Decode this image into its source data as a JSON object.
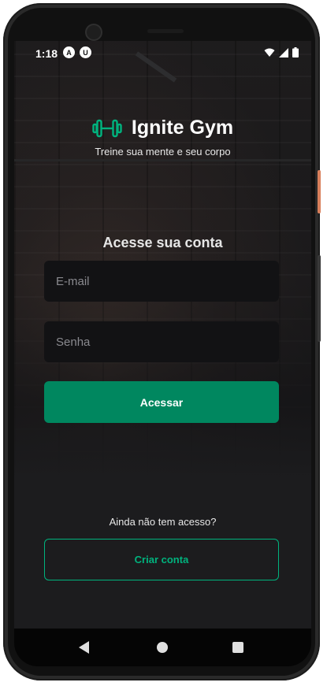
{
  "status_bar": {
    "time": "1:18",
    "notification_icons": [
      "A",
      "U"
    ]
  },
  "brand": {
    "name": "Ignite Gym",
    "tagline": "Treine sua mente e seu corpo",
    "icon": "dumbbell-icon",
    "accent_color": "#00b37e"
  },
  "login": {
    "heading": "Acesse sua conta",
    "email_placeholder": "E-mail",
    "password_placeholder": "Senha",
    "submit_label": "Acessar",
    "button_color": "#00875f"
  },
  "signup": {
    "prompt": "Ainda não tem acesso?",
    "button_label": "Criar conta"
  },
  "nav_bar": {
    "buttons": [
      "back",
      "home",
      "recents"
    ]
  }
}
